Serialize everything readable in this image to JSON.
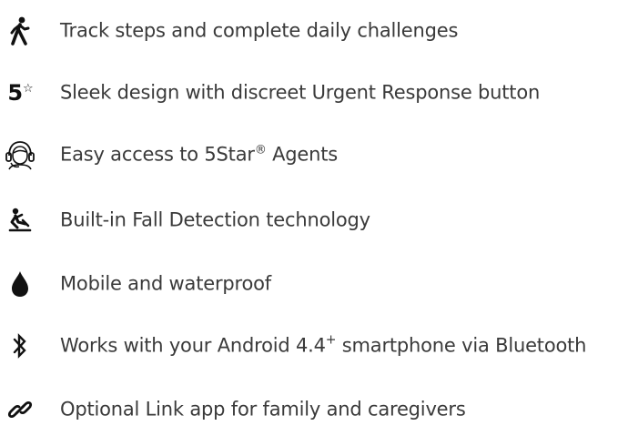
{
  "features": {
    "steps": {
      "icon": "walking-person-icon",
      "text": "Track steps and complete daily challenges"
    },
    "design": {
      "icon": "5star-logo-icon",
      "logo_text": "5",
      "logo_star": "☆",
      "text": "Sleek design with discreet Urgent Response button"
    },
    "agents": {
      "icon": "agent-headset-icon",
      "text_before": "Easy access to 5Star",
      "reg_mark": "®",
      "text_after": " Agents"
    },
    "fall": {
      "icon": "fall-detection-icon",
      "text": "Built-in Fall Detection technology"
    },
    "waterproof": {
      "icon": "water-drop-icon",
      "text": "Mobile and waterproof"
    },
    "bluetooth": {
      "icon": "bluetooth-icon",
      "text_before": "Works with your Android 4.4",
      "sup": "+",
      "text_after": " smartphone via Bluetooth"
    },
    "link": {
      "icon": "link-icon",
      "text": "Optional Link app for family and caregivers"
    }
  }
}
